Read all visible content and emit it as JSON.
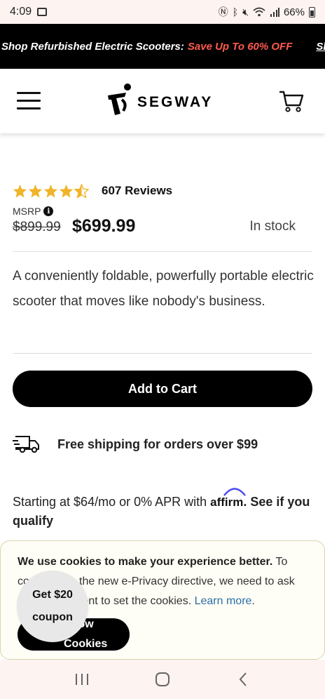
{
  "status_bar": {
    "time": "4:09",
    "battery": "66%"
  },
  "promo": {
    "text": "Shop Refurbished Electric Scooters:",
    "highlight": "Save Up To 60% OFF",
    "highlight_color": "#ff5b4f",
    "link": "Shop"
  },
  "header": {
    "logo_text": "SEGWAY"
  },
  "carousel": {
    "dot_count": 3,
    "active_index": 0
  },
  "product": {
    "rating": 4.5,
    "reviews": "607 Reviews",
    "msrp_label": "MSRP",
    "old_price": "$899.99",
    "price": "$699.99",
    "stock": "In stock",
    "description": "A conveniently foldable, powerfully portable electric scooter that moves like nobody's business.",
    "add_to_cart": "Add to Cart",
    "star_color": "#f0b429"
  },
  "shipping": {
    "text": "Free shipping for orders over $99"
  },
  "affirm": {
    "prefix": "Starting at $64/mo or 0% APR with",
    "logo": "affirm",
    "suffix": ". See if you qualify",
    "arc_color": "#4a4af4"
  },
  "cookie": {
    "bold": "We use cookies to make your experience better.",
    "text": " To comply with the new e-Privacy directive, we need to ask for your consent to set the cookies.",
    "link": "Learn more",
    "after_link": ".",
    "button": "Allow Cookies"
  },
  "coupon": {
    "line1": "Get $20",
    "line2": "coupon"
  }
}
